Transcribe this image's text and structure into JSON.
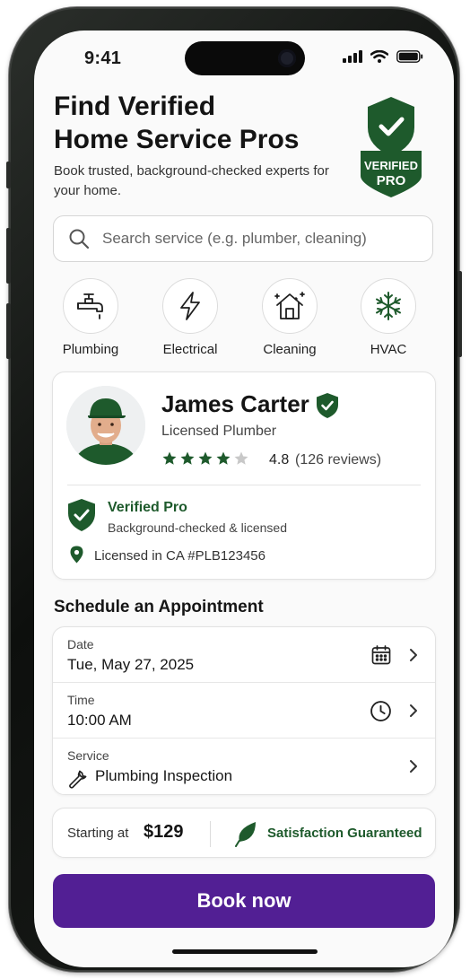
{
  "status_bar": {
    "time": "9:41"
  },
  "header": {
    "title_line1": "Find Verified",
    "title_line2": "Home Service Pros",
    "subtitle": "Book trusted, background-checked experts for your home.",
    "badge_line1": "VERIFIED",
    "badge_line2": "PRO"
  },
  "search": {
    "placeholder": "Search service (e.g. plumber, cleaning)",
    "icon": "search-icon"
  },
  "categories": [
    {
      "label": "Plumbing",
      "icon": "faucet-icon"
    },
    {
      "label": "Electrical",
      "icon": "lightning-icon"
    },
    {
      "label": "Cleaning",
      "icon": "house-sparkle-icon"
    },
    {
      "label": "HVAC",
      "icon": "snowflake-icon"
    }
  ],
  "pro": {
    "name": "James Carter",
    "title": "Licensed Plumber",
    "rating": "4.8",
    "rating_value": 4.8,
    "reviews": "(126 reviews)",
    "verified_title": "Verified Pro",
    "verified_sub": "Background-checked & licensed",
    "license": "Licensed in CA #PLB123456"
  },
  "schedule": {
    "heading": "Schedule an Appointment",
    "rows": [
      {
        "label": "Date",
        "value": "Tue, May 27, 2025",
        "icon": "calendar-icon"
      },
      {
        "label": "Time",
        "value": "10:00 AM",
        "icon": "clock-icon"
      },
      {
        "label": "Service",
        "value": "Plumbing Inspection",
        "icon": "wrench-icon"
      }
    ]
  },
  "pricing": {
    "starting_label": "Starting at",
    "price": "$129",
    "guarantee": "Satisfaction Guaranteed"
  },
  "cta": {
    "label": "Book now"
  },
  "colors": {
    "brand_green": "#1e5a2c",
    "cta_purple": "#521f94",
    "star_empty": "#c8c8c8"
  }
}
